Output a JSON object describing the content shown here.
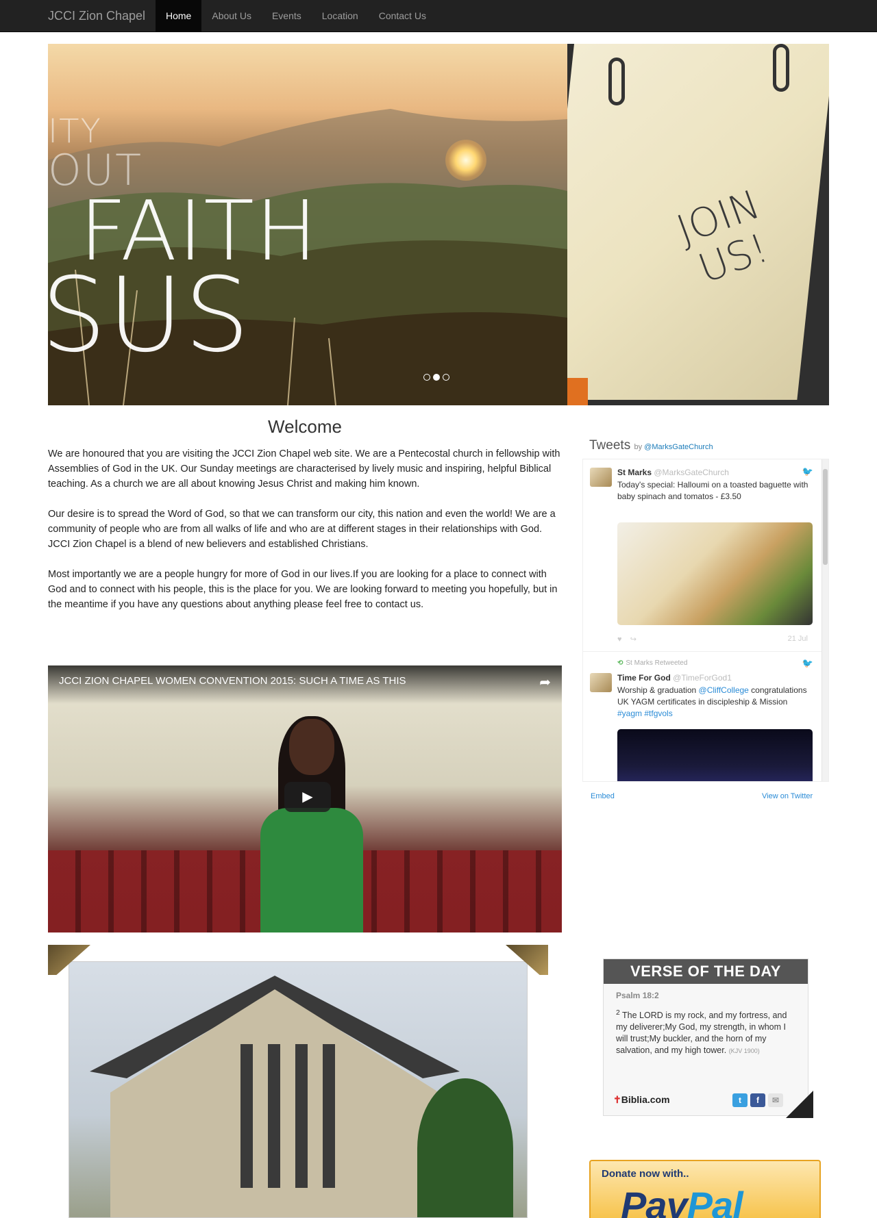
{
  "nav": {
    "brand": "JCCI Zion Chapel",
    "items": [
      {
        "label": "Home",
        "active": true
      },
      {
        "label": "About Us"
      },
      {
        "label": "Events"
      },
      {
        "label": "Location"
      },
      {
        "label": "Contact Us"
      }
    ]
  },
  "hero": {
    "text_lines": [
      "ITY",
      "OUT",
      "FAITH",
      "SUS"
    ],
    "side_text_line1": "JOIN",
    "side_text_line2": "US!",
    "slide_count": 3,
    "active_slide": 2
  },
  "welcome": {
    "title": "Welcome",
    "paragraphs": [
      "We are honoured that you are visiting the JCCI Zion Chapel web site. We are a Pentecostal church in fellowship with Assemblies of God in the UK. Our Sunday meetings are characterised by lively music and inspiring, helpful Biblical teaching. As a church we are all about knowing Jesus Christ and making him known.",
      "Our desire is to spread the Word of God, so that we can transform our city, this nation and even the world! We are a community of people who are from all walks of life and who are at different stages in their relationships with God. JCCI Zion Chapel is a blend of new believers and established Christians.",
      "Most importantly we are a people hungry for more of God in our lives.If you are looking for a place to connect with God and to connect with his people, this is the place for you. We are looking forward to meeting you hopefully, but in the meantime if you have any questions about anything please feel free to contact us."
    ]
  },
  "video": {
    "title": "JCCI ZION CHAPEL WOMEN CONVENTION 2015: SUCH A TIME AS THIS"
  },
  "tweets": {
    "heading": "Tweets",
    "by": "by",
    "account": "@MarksGateChurch",
    "items": [
      {
        "name": "St Marks",
        "handle": "@MarksGateChurch",
        "text": "Today's special: Halloumi on a toasted baguette with baby spinach and tomatos - £3.50",
        "date": "21 Jul"
      },
      {
        "retweeted_by": "St Marks Retweeted",
        "name": "Time For God",
        "handle": "@TimeForGod1",
        "text_prefix": "Worship & graduation ",
        "mention": "@CliffCollege",
        "text_middle": " congratulations UK YAGM certificates in discipleship & Mission ",
        "hashtags": "#yagm #tfgvols"
      }
    ],
    "embed_label": "Embed",
    "view_label": "View on Twitter"
  },
  "verse": {
    "heading": "VERSE OF THE DAY",
    "reference": "Psalm 18:2",
    "verse_number": "2",
    "text": "The LORD is my rock, and my fortress, and my deliverer;My God, my strength, in whom I will trust;My buckler, and the horn of my salvation, and my high tower.",
    "version": "(KJV 1900)",
    "brand": "Biblia.com"
  },
  "paypal": {
    "label": "Donate now with..",
    "logo_pay": "Pay",
    "logo_pal": "Pal"
  }
}
